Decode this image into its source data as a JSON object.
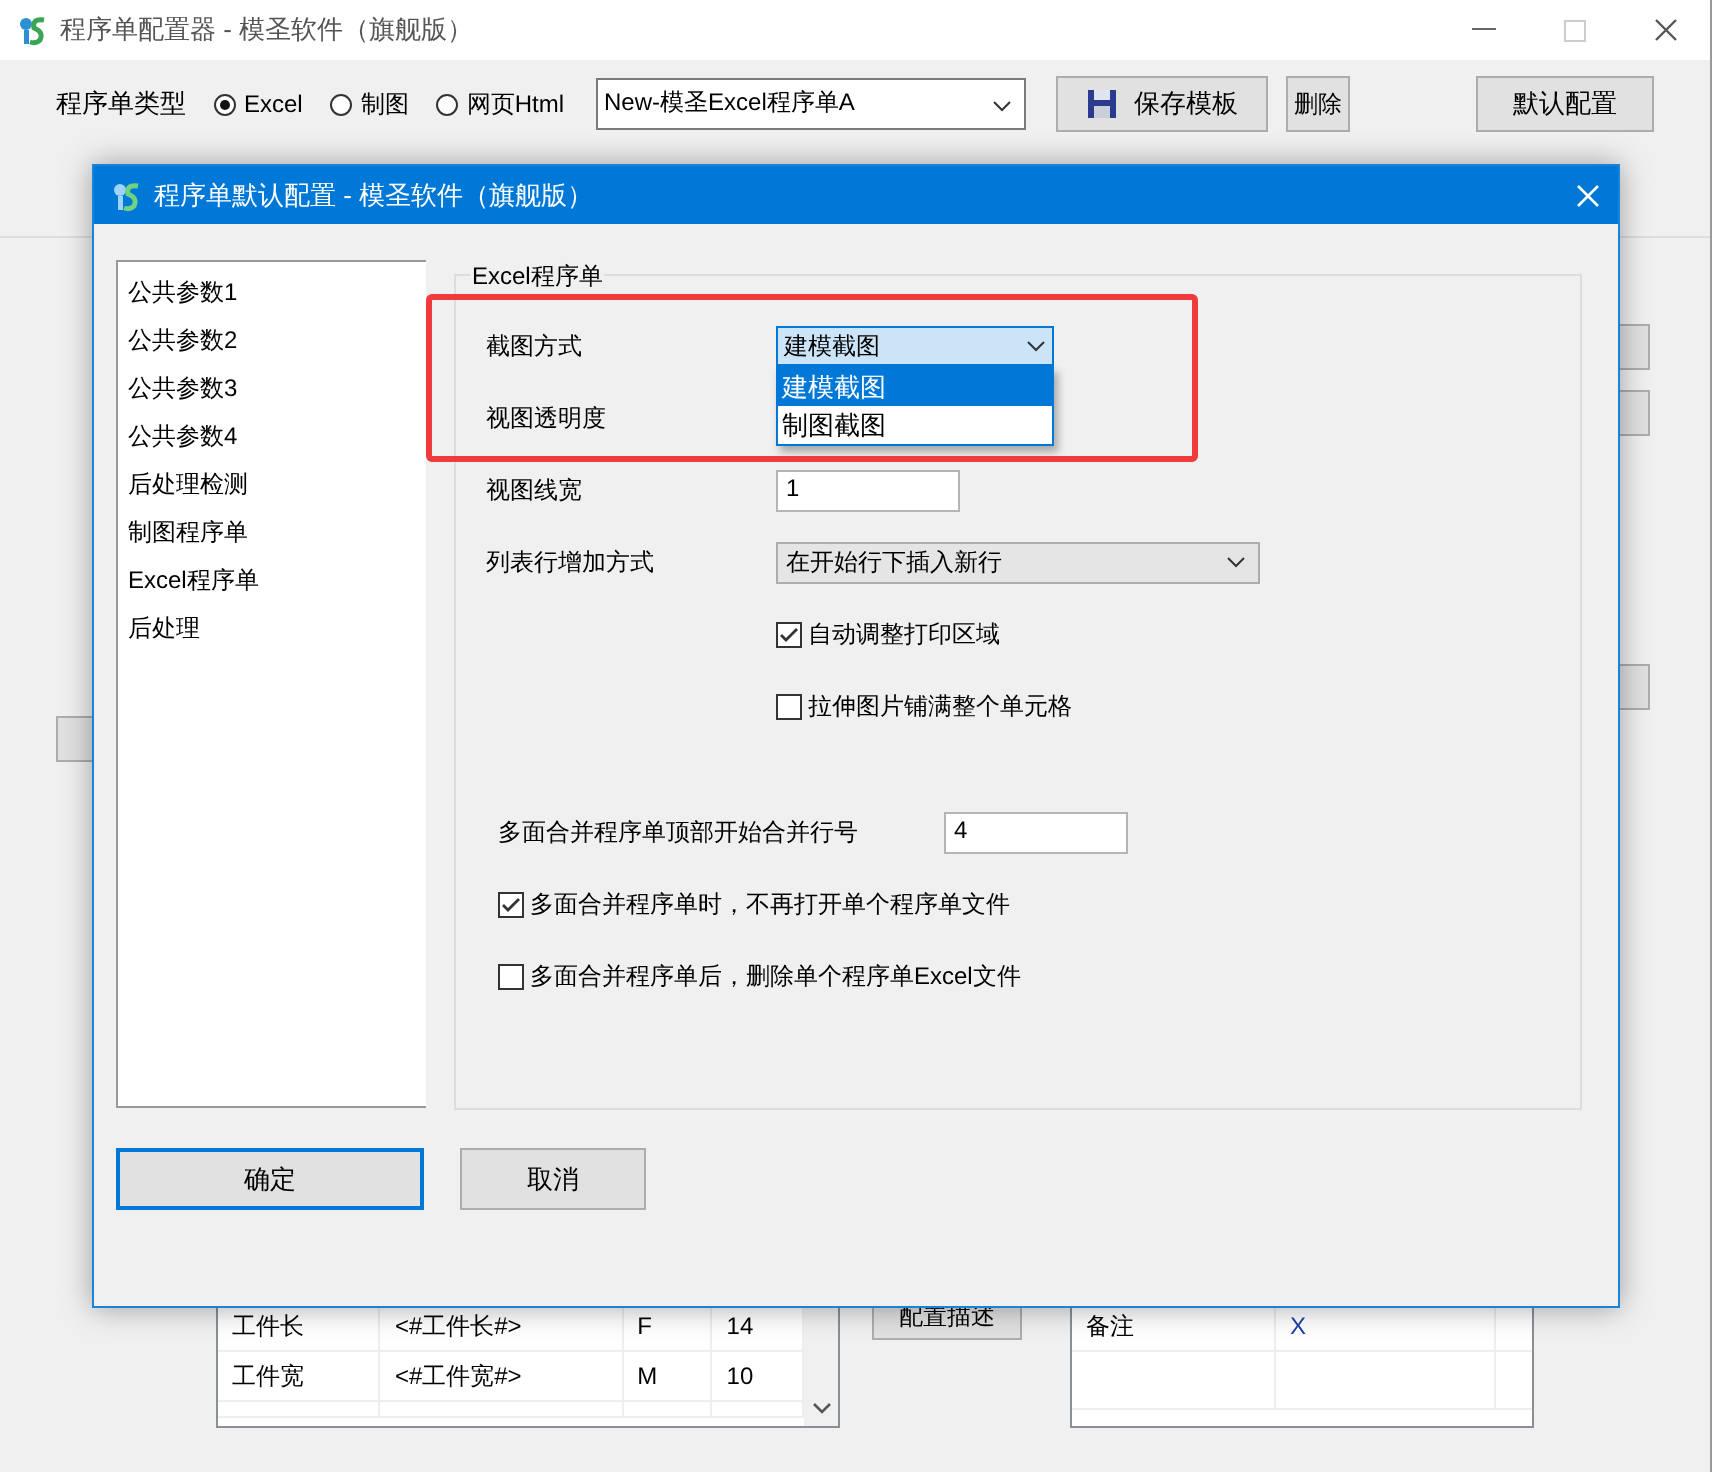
{
  "main_window": {
    "title": "程序单配置器 - 模圣软件（旗舰版）",
    "type_label": "程序单类型",
    "type_options": [
      {
        "label": "Excel",
        "selected": true
      },
      {
        "label": "制图",
        "selected": false
      },
      {
        "label": "网页Html",
        "selected": false
      }
    ],
    "template": "New-模圣Excel程序单A",
    "buttons": [
      {
        "label": "保存模板",
        "kind": "save"
      },
      {
        "label": "删除",
        "kind": "small"
      },
      {
        "label": "默认配置",
        "kind": "wide"
      }
    ],
    "left_table": {
      "rows": [
        [
          "工件长",
          "<#工件长#>",
          "F",
          "14"
        ],
        [
          "工件宽",
          "<#工件宽#>",
          "M",
          "10"
        ]
      ]
    },
    "describe_button": "配置描述",
    "right_table": {
      "rows": [
        [
          "备注",
          "X"
        ]
      ]
    }
  },
  "dialog": {
    "title": "程序单默认配置 - 模圣软件（旗舰版）",
    "nav": [
      "公共参数1",
      "公共参数2",
      "公共参数3",
      "公共参数4",
      "后处理检测",
      "制图程序单",
      "Excel程序单",
      "后处理"
    ],
    "group_title": "Excel程序单",
    "highlight_box": true,
    "fields": [
      {
        "kind": "dropdown",
        "label": "截图方式",
        "value": "建模截图",
        "expanded": true,
        "options": [
          {
            "label": "建模截图",
            "selected": true
          },
          {
            "label": "制图截图",
            "selected": false
          }
        ]
      },
      {
        "kind": "covered",
        "label": "视图透明度"
      },
      {
        "kind": "text",
        "label": "视图线宽",
        "value": "1"
      },
      {
        "kind": "select",
        "label": "列表行增加方式",
        "value": "在开始行下插入新行"
      },
      {
        "kind": "check",
        "label": "自动调整打印区域",
        "checked": true
      },
      {
        "kind": "check",
        "label": "拉伸图片铺满整个单元格",
        "checked": false
      }
    ],
    "merge_row": {
      "label": "多面合并程序单顶部开始合并行号",
      "value": "4"
    },
    "merge_options": [
      {
        "label": "多面合并程序单时，不再打开单个程序单文件",
        "checked": true
      },
      {
        "label": "多面合并程序单后，删除单个程序单Excel文件",
        "checked": false
      }
    ],
    "buttons": [
      {
        "label": "确定",
        "default": true
      },
      {
        "label": "取消",
        "default": false
      }
    ]
  }
}
